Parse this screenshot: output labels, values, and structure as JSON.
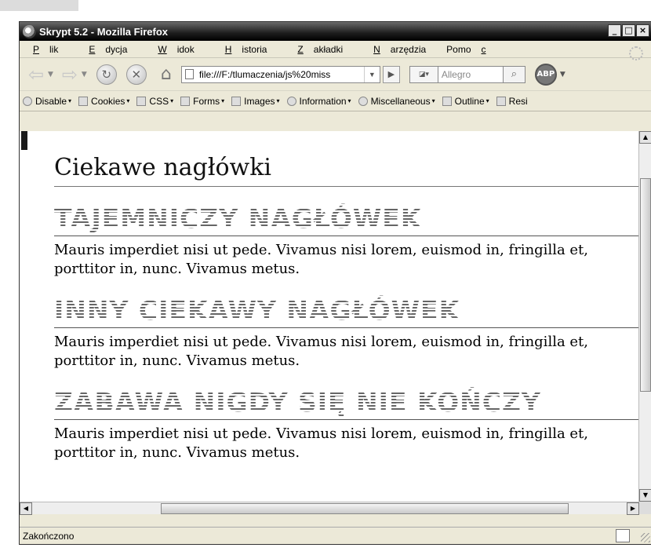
{
  "window": {
    "title": "Skrypt 5.2 - Mozilla Firefox",
    "controls": {
      "minimize": "_",
      "maximize": "□",
      "close": "×"
    }
  },
  "menubar": {
    "items": [
      {
        "pre": "",
        "u": "P",
        "post": "lik"
      },
      {
        "pre": "",
        "u": "E",
        "post": "dycja"
      },
      {
        "pre": "",
        "u": "W",
        "post": "idok"
      },
      {
        "pre": "",
        "u": "H",
        "post": "istoria"
      },
      {
        "pre": "",
        "u": "Z",
        "post": "akładki"
      },
      {
        "pre": "",
        "u": "N",
        "post": "arzędzia"
      },
      {
        "pre": "Pomo",
        "u": "c",
        "post": ""
      }
    ]
  },
  "navbar": {
    "url": "file:///F:/tlumaczenia/js%20miss",
    "search_engine_icon": "search-engine-icon",
    "search_placeholder": "Allegro",
    "abp_label": "ABP"
  },
  "devbar": {
    "items": [
      "Disable",
      "Cookies",
      "CSS",
      "Forms",
      "Images",
      "Information",
      "Miscellaneous",
      "Outline",
      "Resi"
    ]
  },
  "page": {
    "title": "Ciekawe nagłówki",
    "sections": [
      {
        "heading": "TAJEMNICZY NAGŁÓWEK",
        "text": "Mauris imperdiet nisi ut pede. Vivamus nisi lorem, euismod in, fringilla et, porttitor in, nunc. Vivamus metus."
      },
      {
        "heading": "INNY CIEKAWY NAGŁÓWEK",
        "text": "Mauris imperdiet nisi ut pede. Vivamus nisi lorem, euismod in, fringilla et, porttitor in, nunc. Vivamus metus."
      },
      {
        "heading": "ZABAWA NIGDY SIĘ NIE KOŃCZY",
        "text": "Mauris imperdiet nisi ut pede. Vivamus nisi lorem, euismod in, fringilla et, porttitor in, nunc. Vivamus metus."
      }
    ]
  },
  "statusbar": {
    "text": "Zakończono"
  }
}
